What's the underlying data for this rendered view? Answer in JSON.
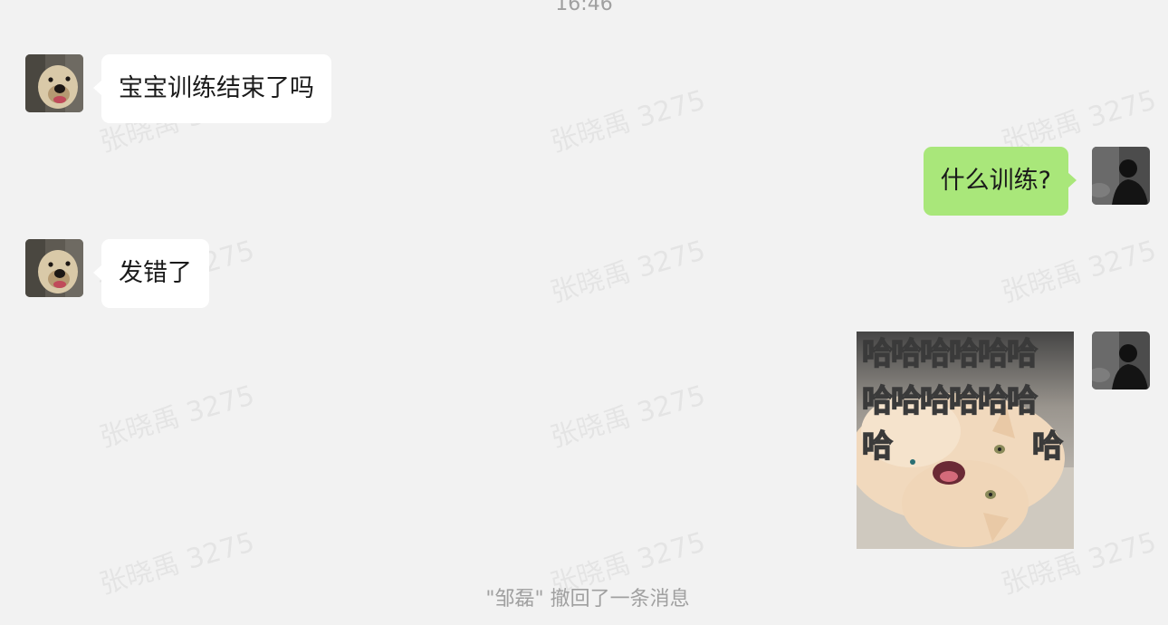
{
  "chat": {
    "timestamp": "16:46",
    "watermark_text": "张晓禹 3275",
    "messages": [
      {
        "sender": "other",
        "avatar": "dog-avatar",
        "text": "宝宝训练结束了吗"
      },
      {
        "sender": "self",
        "avatar": "silhouette-avatar",
        "text": "什么训练?"
      },
      {
        "sender": "other",
        "avatar": "dog-avatar",
        "text": "发错了"
      },
      {
        "sender": "self",
        "avatar": "silhouette-avatar",
        "type": "sticker",
        "sticker": {
          "line1": "哈哈哈哈哈哈",
          "line2": "哈哈哈哈哈哈",
          "line3_left": "哈",
          "line3_right": "哈",
          "subject": "laughing-cat"
        }
      }
    ],
    "recall_notice": "\"邹磊\" 撤回了一条消息"
  },
  "colors": {
    "background": "#f2f2f2",
    "incoming_bubble": "#ffffff",
    "outgoing_bubble": "#a9e77a",
    "system_text": "#a0a0a0"
  }
}
